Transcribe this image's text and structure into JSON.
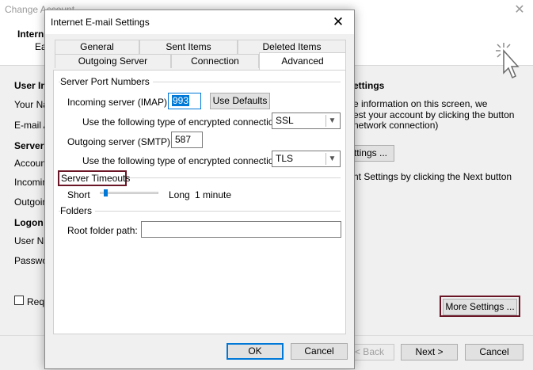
{
  "background_window": {
    "title": "Change Account",
    "close_glyph": "✕",
    "header_title": "Intern",
    "header_subtitle": "Ea",
    "sections": {
      "user_info": "User In",
      "your_name": "Your Nam",
      "email_address": "E-mail Ad",
      "server_info": "Server",
      "account_type": "Account",
      "incoming": "Incoming",
      "outgoing": "Outgoing",
      "logon_info": "Logon I",
      "user_name": "User Nam",
      "password": "Passwor",
      "require_checkbox_label": "Requ"
    },
    "right_panel": {
      "heading": "ettings",
      "line1": "e information on this screen, we",
      "line2": "est your account by clicking the button",
      "line3": "network connection)",
      "test_button": "ettings ...",
      "next_hint": "nt Settings by clicking the Next button"
    },
    "more_settings_button": "More Settings ...",
    "footer": {
      "back": "< Back",
      "next": "Next >",
      "cancel": "Cancel"
    }
  },
  "dialog": {
    "title": "Internet E-mail Settings",
    "close_glyph": "✕",
    "tabs_row1": [
      "General",
      "Sent Items",
      "Deleted Items"
    ],
    "tabs_row2": [
      "Outgoing Server",
      "Connection",
      "Advanced"
    ],
    "active_tab": "Advanced",
    "server_ports": {
      "group_title": "Server Port Numbers",
      "incoming_label": "Incoming server (IMAP):",
      "incoming_value": "993",
      "use_defaults": "Use Defaults",
      "incoming_enc_label": "Use the following type of encrypted connection:",
      "incoming_enc_value": "SSL",
      "outgoing_label": "Outgoing server (SMTP):",
      "outgoing_value": "587",
      "outgoing_enc_label": "Use the following type of encrypted connection:",
      "outgoing_enc_value": "TLS"
    },
    "server_timeouts": {
      "group_title": "Server Timeouts",
      "short_label": "Short",
      "long_label": "Long",
      "value_text": "1 minute",
      "slider_level": 0.07
    },
    "folders": {
      "group_title": "Folders",
      "root_label": "Root folder path:",
      "root_value": ""
    },
    "buttons": {
      "ok": "OK",
      "cancel": "Cancel"
    }
  },
  "colors": {
    "highlight_box": "#6b1626",
    "accent": "#0078d7"
  },
  "icons": {
    "dropdown": "chevron-down-icon",
    "pointer": "click-cursor-icon"
  }
}
